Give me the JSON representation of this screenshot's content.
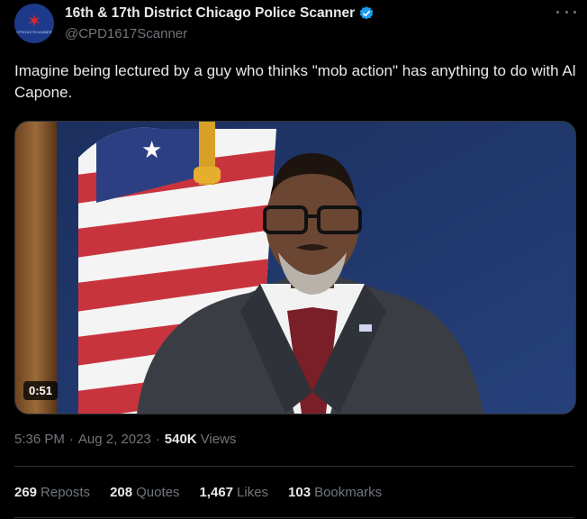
{
  "author": {
    "display_name": "16th & 17th District Chicago Police Scanner",
    "handle": "@CPD1617Scanner",
    "avatar_text": "CPD1617SCANNER",
    "verified_icon": "verified-badge-icon",
    "avatar_color": "#1d3a8a"
  },
  "tweet": {
    "text": "Imagine being lectured by a guy who thinks \"mob action\" has anything to do with Al Capone."
  },
  "media": {
    "duration": "0:51"
  },
  "meta": {
    "time": "5:36 PM",
    "date": "Aug 2, 2023",
    "views_count": "540K",
    "views_label": "Views"
  },
  "stats": {
    "reposts_count": "269",
    "reposts_label": "Reposts",
    "quotes_count": "208",
    "quotes_label": "Quotes",
    "likes_count": "1,467",
    "likes_label": "Likes",
    "bookmarks_count": "103",
    "bookmarks_label": "Bookmarks"
  },
  "colors": {
    "background": "#000000",
    "text": "#e7e9ea",
    "muted": "#71767b",
    "verified": "#1d9bf0",
    "divider": "#2f3336"
  }
}
